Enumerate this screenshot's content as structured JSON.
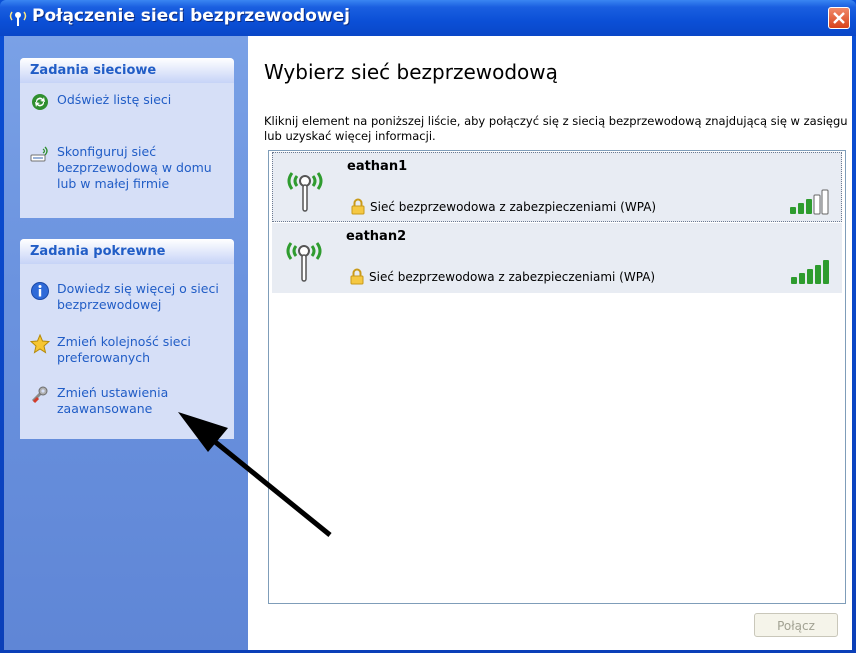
{
  "window": {
    "title": "Połączenie sieci bezprzewodowej"
  },
  "sidebar": {
    "network_tasks": {
      "title": "Zadania sieciowe",
      "items": [
        {
          "label": "Odśwież listę sieci",
          "icon": "refresh-icon"
        },
        {
          "label": "Skonfiguruj sieć\nbezprzewodową w domu\nlub w małej firmie",
          "icon": "wireless-setup-icon"
        }
      ]
    },
    "related_tasks": {
      "title": "Zadania pokrewne",
      "items": [
        {
          "label": "Dowiedz się więcej o sieci\nbezprzewodowej",
          "icon": "info-icon"
        },
        {
          "label": "Zmień kolejność sieci\npreferowanych",
          "icon": "star-icon"
        },
        {
          "label": "Zmień ustawienia\nzaawansowane",
          "icon": "settings-icon"
        }
      ]
    }
  },
  "main": {
    "heading": "Wybierz sieć bezprzewodową",
    "instructions": "Kliknij element na poniższej liście, aby połączyć się z siecią bezprzewodową znajdującą się w zasięgu lub uzyskać więcej informacji.",
    "networks": [
      {
        "name": "eathan1",
        "security": "Sieć bezprzewodowa z zabezpieczeniami (WPA)",
        "signal_bars": 3,
        "selected": true
      },
      {
        "name": "eathan2",
        "security": "Sieć bezprzewodowa z zabezpieczeniami (WPA)",
        "signal_bars": 5,
        "selected": false
      }
    ],
    "connect_button": "Połącz"
  },
  "colors": {
    "title_bar": "#0b4fd6",
    "sidebar_bg": "#6b93df",
    "taskbox_bg": "#d6dff7",
    "link": "#215dc6",
    "signal_on": "#2e9c2e",
    "close_button": "#d8431b"
  }
}
